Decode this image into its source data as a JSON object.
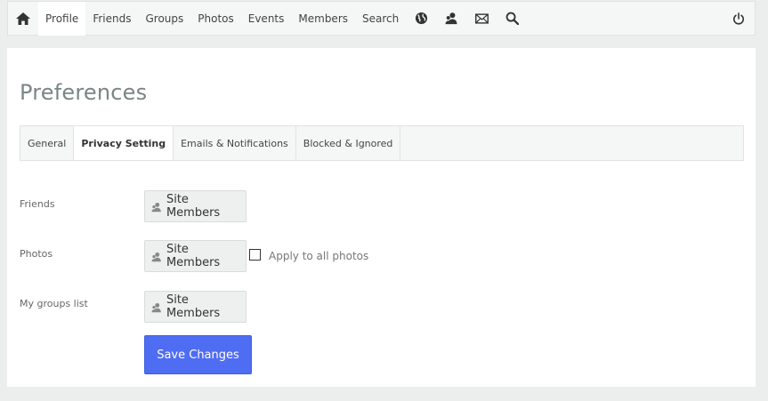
{
  "nav": {
    "links": [
      "Profile",
      "Friends",
      "Groups",
      "Photos",
      "Events",
      "Members",
      "Search"
    ],
    "active": "Profile",
    "icons": [
      "globe-icon",
      "members-icon",
      "mail-icon",
      "search-icon"
    ],
    "power": "power-icon"
  },
  "page": {
    "title": "Preferences"
  },
  "tabs": {
    "items": [
      "General",
      "Privacy Setting",
      "Emails & Notifications",
      "Blocked & Ignored"
    ],
    "active": "Privacy Setting"
  },
  "settings": {
    "friends": {
      "label": "Friends",
      "value": "Site Members"
    },
    "photos": {
      "label": "Photos",
      "value": "Site Members",
      "apply_all_label": "Apply to all photos",
      "apply_all_checked": false
    },
    "groups": {
      "label": "My groups list",
      "value": "Site Members"
    }
  },
  "actions": {
    "save_label": "Save Changes"
  },
  "colors": {
    "accent": "#4f6df2",
    "background": "#eceeee"
  }
}
